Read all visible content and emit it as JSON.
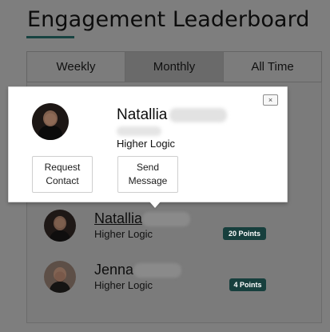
{
  "page": {
    "title": "Engagement Leaderboard"
  },
  "tabs": [
    {
      "label": "Weekly"
    },
    {
      "label": "Monthly"
    },
    {
      "label": "All Time"
    }
  ],
  "popover": {
    "name_first": "Natallia",
    "organization": "Higher Logic",
    "close_label": "×",
    "request_line1": "Request",
    "request_line2": "Contact",
    "message_line1": "Send",
    "message_line2": "Message"
  },
  "leaderboard": [
    {
      "name_first": "Natallia",
      "organization": "Higher Logic",
      "points_label": "20 Points"
    },
    {
      "name_first": "Jenna",
      "organization": "Higher Logic",
      "points_label": "4 Points"
    }
  ]
}
